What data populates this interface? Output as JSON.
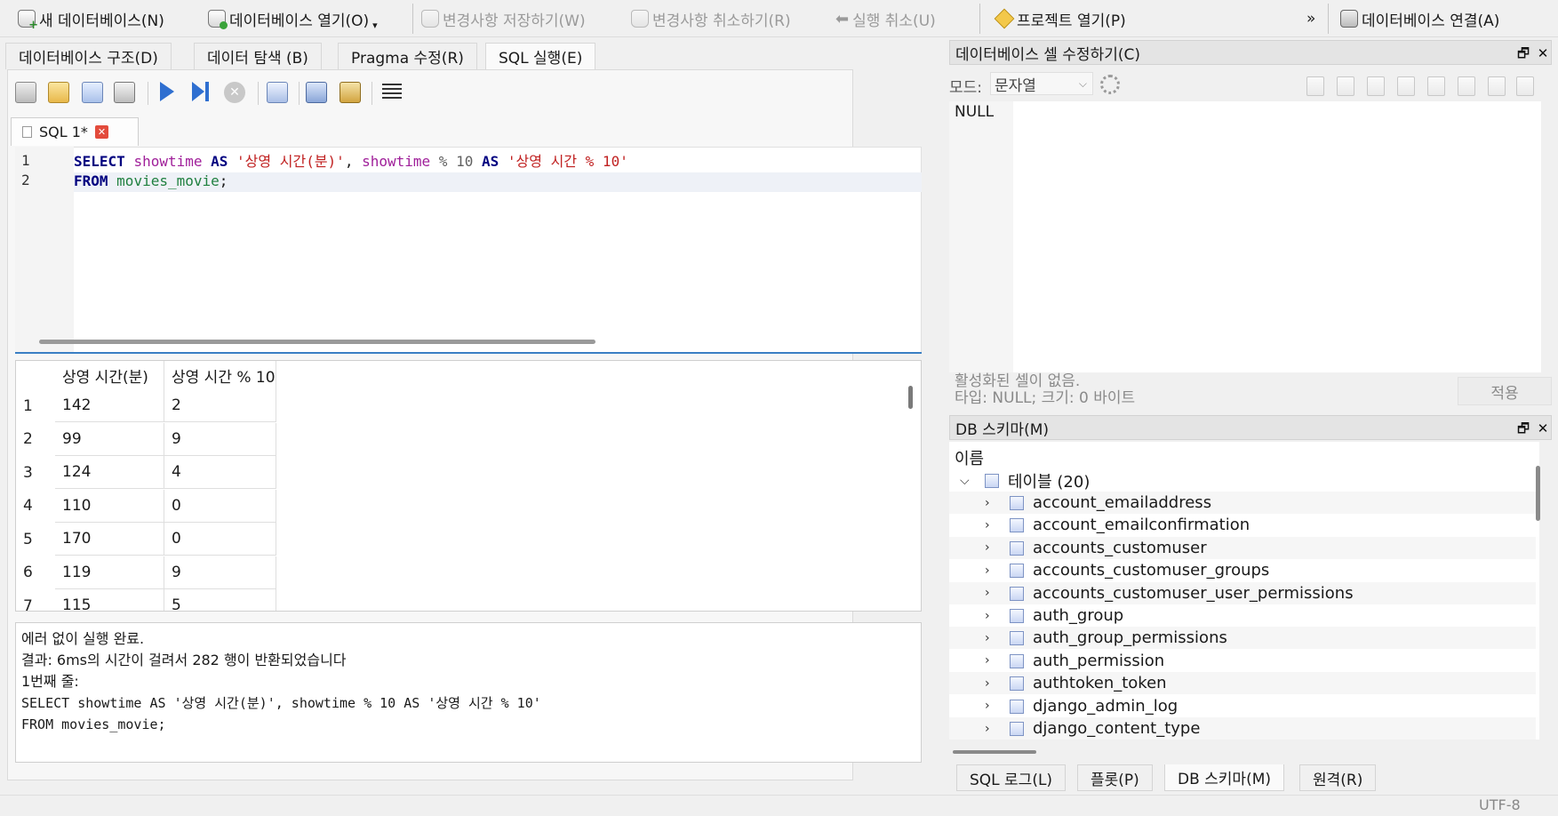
{
  "toolbar": {
    "new_db": "새 데이터베이스(N)",
    "open_db": "데이터베이스 열기(O)",
    "write_changes": "변경사항 저장하기(W)",
    "revert_changes": "변경사항 취소하기(R)",
    "undo": "실행 취소(U)",
    "open_project": "프로젝트 열기(P)",
    "overflow": "»",
    "attach_db": "데이터베이스 연결(A)"
  },
  "main_tabs": [
    {
      "label": "데이터베이스 구조(D)"
    },
    {
      "label": "데이터 탐색 (B)"
    },
    {
      "label": "Pragma 수정(R)"
    },
    {
      "label": "SQL 실행(E)"
    }
  ],
  "editor": {
    "tab_label": "SQL 1*",
    "line_numbers": [
      "1",
      "2"
    ],
    "line1": {
      "kw1": "SELECT",
      "col1": "showtime",
      "kw2": "AS",
      "str1": "'상영 시간(분)'",
      "comma": ",",
      "col2": "showtime",
      "op": "%",
      "n": "10",
      "kw3": "AS",
      "str2": "'상영 시간 % 10'"
    },
    "line2": {
      "kw": "FROM",
      "tbl": "movies_movie",
      "semi": ";"
    }
  },
  "results": {
    "columns": [
      "상영 시간(분)",
      "상영 시간 % 10"
    ],
    "rows": [
      {
        "n": "1",
        "a": "142",
        "b": "2"
      },
      {
        "n": "2",
        "a": "99",
        "b": "9"
      },
      {
        "n": "3",
        "a": "124",
        "b": "4"
      },
      {
        "n": "4",
        "a": "110",
        "b": "0"
      },
      {
        "n": "5",
        "a": "170",
        "b": "0"
      },
      {
        "n": "6",
        "a": "119",
        "b": "9"
      },
      {
        "n": "7",
        "a": "115",
        "b": "5"
      }
    ]
  },
  "message": {
    "line1": "에러 없이 실행 완료.",
    "line2": "결과: 6ms의 시간이 걸려서 282 행이 반환되었습니다",
    "line3": "1번째 줄:",
    "line4": "SELECT showtime AS '상영 시간(분)', showtime % 10 AS '상영 시간 % 10'",
    "line5": "FROM movies_movie;"
  },
  "cell_editor": {
    "title": "데이터베이스 셀 수정하기(C)",
    "mode_label": "모드:",
    "mode_value": "문자열",
    "value": "NULL",
    "status1": "활성화된 셀이 없음.",
    "status2": "타입: NULL; 크기: 0 바이트",
    "apply": "적용"
  },
  "schema": {
    "title": "DB 스키마(M)",
    "col_header": "이름",
    "tables_group": "테이블 (20)",
    "tables": [
      "account_emailaddress",
      "account_emailconfirmation",
      "accounts_customuser",
      "accounts_customuser_groups",
      "accounts_customuser_user_permissions",
      "auth_group",
      "auth_group_permissions",
      "auth_permission",
      "authtoken_token",
      "django_admin_log",
      "django_content_type"
    ]
  },
  "bottom_tabs": [
    {
      "label": "SQL 로그(L)"
    },
    {
      "label": "플롯(P)"
    },
    {
      "label": "DB 스키마(M)"
    },
    {
      "label": "원격(R)"
    }
  ],
  "status_bar": {
    "encoding": "UTF-8"
  },
  "panel_buttons": {
    "float": "🗗",
    "close": "✕"
  }
}
